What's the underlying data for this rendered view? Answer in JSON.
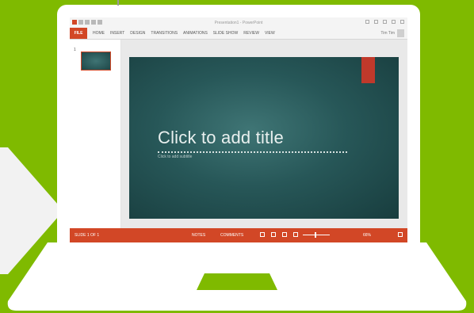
{
  "app": {
    "window_title": "Presentation1 - PowerPoint",
    "brand_color": "#d24726",
    "background_color": "#7fba00"
  },
  "ribbon": {
    "file_label": "FILE",
    "tabs": [
      "HOME",
      "INSERT",
      "DESIGN",
      "TRANSITIONS",
      "ANIMATIONS",
      "SLIDE SHOW",
      "REVIEW",
      "VIEW"
    ],
    "user_name": "Tim Tim"
  },
  "thumbnails": {
    "slide_number": "1"
  },
  "slide": {
    "title_placeholder": "Click to add title",
    "subtitle_placeholder": "Click to add subtitle",
    "accent_color": "#c0392b"
  },
  "statusbar": {
    "slide_indicator": "SLIDE 1 OF 1",
    "notes_label": "NOTES",
    "comments_label": "COMMENTS",
    "zoom_level": "66%"
  }
}
